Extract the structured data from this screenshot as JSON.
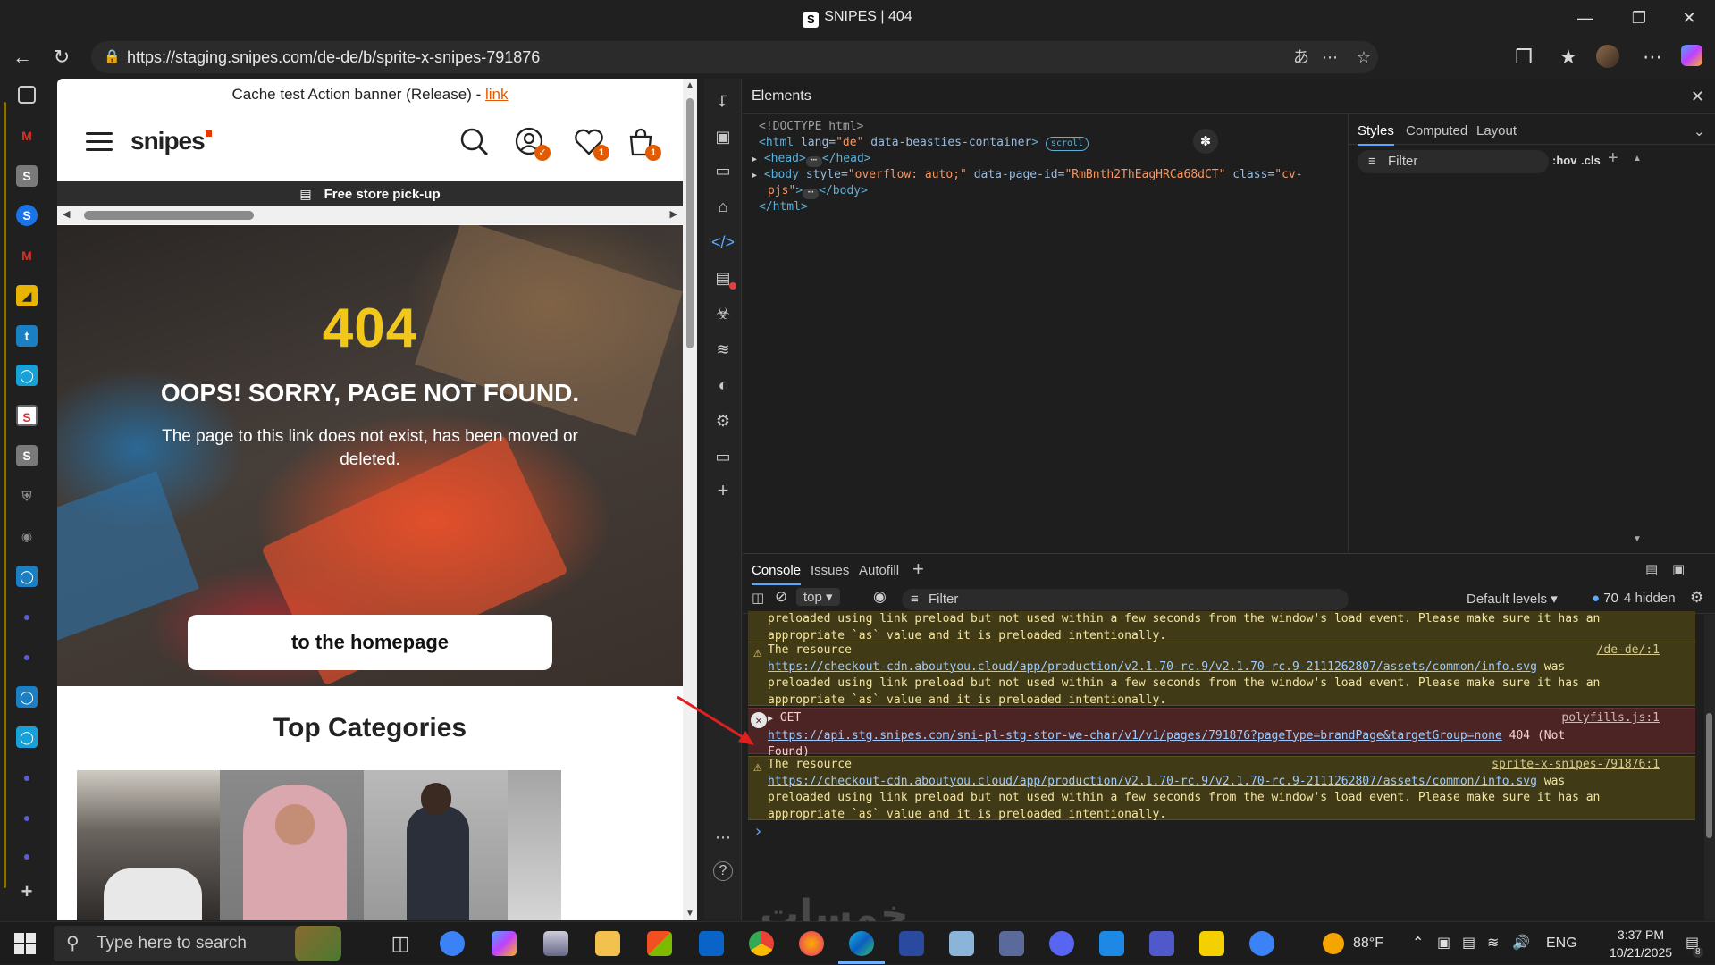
{
  "window": {
    "title": "SNIPES | 404",
    "fav": "S"
  },
  "browser": {
    "url": "https://staging.snipes.com/de-de/b/sprite-x-snipes-791876"
  },
  "page": {
    "banner_text": "Cache test Action banner (Release) - ",
    "banner_link": "link",
    "logo": "snipes",
    "wishlist_badge": "1",
    "cart_badge": "1",
    "pickup": "Free store pick-up",
    "error_code": "404",
    "headline": "OOPS! SORRY, PAGE NOT FOUND.",
    "message": "The page to this link does not exist, has been moved or deleted.",
    "home_button": "to the homepage",
    "top_categories": "Top Categories"
  },
  "devtools": {
    "panel_title": "Elements",
    "tree": {
      "doctype": "<!DOCTYPE html>",
      "html_open": "<html",
      "html_lang_attr": "lang=",
      "html_lang_val": "\"de\"",
      "html_beasties": "data-beasties-container",
      "html_close_bracket": ">",
      "scroll_badge": "scroll",
      "head_open": "<head>",
      "head_close": "</head>",
      "body_open": "<body",
      "body_style_attr": "style=",
      "body_style_val": "\"overflow: auto;\"",
      "body_pageid_attr": "data-page-id=",
      "body_pageid_val": "\"RmBnth2ThEagHRCa68dCT\"",
      "body_class_attr": "class=",
      "body_class_val": "\"cv-",
      "body_class_val2": "pjs\"",
      "body_close": "</body>",
      "html_close": "</html>",
      "ellipsis": "⋯"
    },
    "styles_tabs": [
      "Styles",
      "Computed",
      "Layout"
    ],
    "styles_filter": "Filter",
    "hov": ":hov",
    "cls": ".cls",
    "console_tabs": [
      "Console",
      "Issues",
      "Autofill"
    ],
    "context": "top",
    "console_filter": "Filter",
    "levels": "Default levels",
    "issue_count": "70",
    "hidden": "4 hidden",
    "messages": {
      "w0_line1": "preloaded using link preload but not used within a few seconds from the window's load event. Please make sure it has an",
      "w0_line2": "appropriate `as` value and it is preloaded intentionally.",
      "w1_title": "The resource",
      "w1_source": "/de-de/:1",
      "w1_link": "https://checkout-cdn.aboutyou.cloud/app/production/v2.1.70-rc.9/v2.1.70-rc.9-2111262807/assets/common/info.svg",
      "w1_was": " was",
      "w1_line3": "preloaded using link preload but not used within a few seconds from the window's load event. Please make sure it has an",
      "w1_line4": "appropriate `as` value and it is preloaded intentionally.",
      "e_method": "GET",
      "e_source": "polyfills.js:1",
      "e_link": "https://api.stg.snipes.com/sni-pl-stg-stor-we-char/v1/v1/pages/791876?pageType=brandPage&targetGroup=none",
      "e_status": " 404 (Not",
      "e_status2": "Found)",
      "w2_title": "The resource",
      "w2_source": "sprite-x-snipes-791876:1",
      "w2_link": "https://checkout-cdn.aboutyou.cloud/app/production/v2.1.70-rc.9/v2.1.70-rc.9-2111262807/assets/common/info.svg",
      "w2_was": " was",
      "w2_line3": "preloaded using link preload but not used within a few seconds from the window's load event. Please make sure it has an",
      "w2_line4": "appropriate `as` value and it is preloaded intentionally."
    }
  },
  "taskbar": {
    "search_placeholder": "Type here to search",
    "weather": "88°F",
    "lang": "ENG",
    "time": "3:37 PM",
    "date": "10/21/2025",
    "notif_count": "8"
  },
  "watermark": "خمسات"
}
